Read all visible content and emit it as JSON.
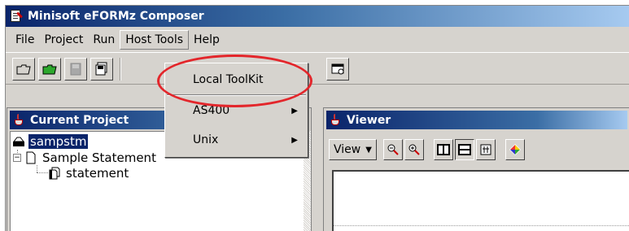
{
  "window": {
    "title": "Minisoft eFORMz Composer"
  },
  "menubar": {
    "items": [
      {
        "label": "File"
      },
      {
        "label": "Project"
      },
      {
        "label": "Run"
      },
      {
        "label": "Host Tools"
      },
      {
        "label": "Help"
      }
    ]
  },
  "host_tools_menu": {
    "items": [
      {
        "label": "Local ToolKit",
        "submenu": false
      },
      {
        "label": "AS400",
        "submenu": true
      },
      {
        "label": "Unix",
        "submenu": true
      }
    ]
  },
  "current_project": {
    "title": "Current Project",
    "tree": [
      {
        "label": "sampstm",
        "selected": true
      },
      {
        "label": "Sample Statement",
        "expander": "−"
      },
      {
        "label": "statement"
      }
    ]
  },
  "viewer": {
    "title": "Viewer",
    "view_combo": "View",
    "dropdown_arrow": "▼",
    "submenu_arrow": "▶"
  },
  "colors": {
    "title_gradient_start": "#0a246a",
    "title_gradient_end": "#a6caf0",
    "highlight_oval": "#e3262b",
    "chrome": "#d6d3ce"
  }
}
